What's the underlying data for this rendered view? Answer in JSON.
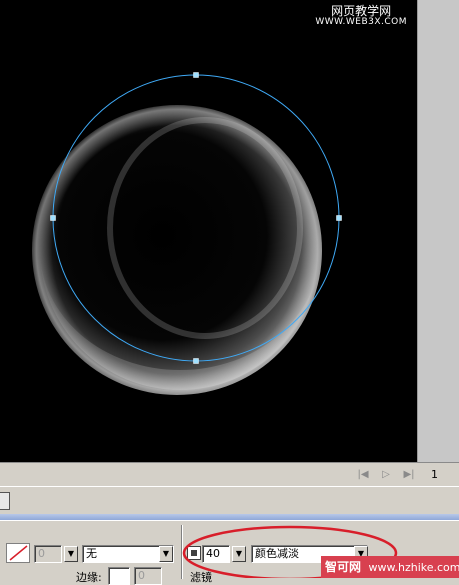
{
  "watermark": {
    "line1": "网页教学网",
    "line2": "WWW.WEB3X.COM"
  },
  "timeline": {
    "page_number": "1"
  },
  "properties": {
    "stroke_width_value": "0",
    "fill_style_value": "无",
    "opacity_value": "40",
    "blend_mode_value": "颜色减淡",
    "edge_label": "边缘:",
    "edge_value": "0",
    "filter_label": "滤镜"
  },
  "banner": {
    "site_name": "智可网",
    "site_url": "www.hzhike.com"
  },
  "colors": {
    "canvas_bg": "#000000",
    "path_stroke": "#3fa9f5",
    "annotation": "#d81e2a"
  }
}
